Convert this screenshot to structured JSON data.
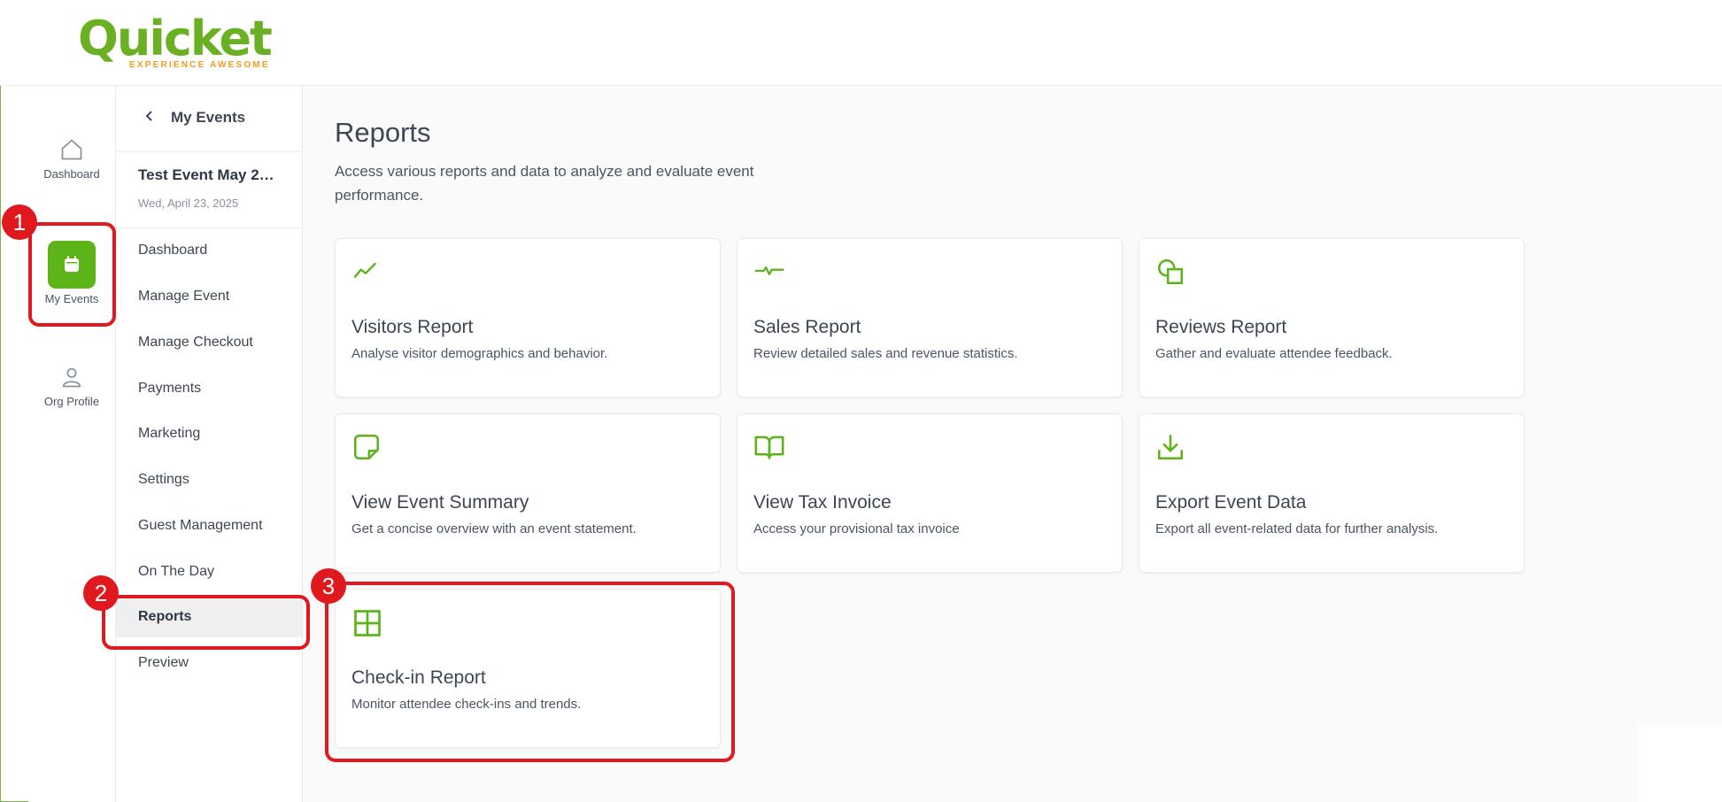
{
  "brand": {
    "name": "Quicket",
    "tagline": "EXPERIENCE AWESOME",
    "color": "#6ab023",
    "tagline_color": "#f39c1f"
  },
  "rail": [
    {
      "label": "Dashboard",
      "icon": "home-icon"
    },
    {
      "label": "My Events",
      "icon": "calendar-icon",
      "active": true
    },
    {
      "label": "Org Profile",
      "icon": "user-icon"
    }
  ],
  "subnav": {
    "back_label": "My Events",
    "event_name": "Test Event May 2…",
    "event_date": "Wed, April 23, 2025",
    "items": [
      "Dashboard",
      "Manage Event",
      "Manage Checkout",
      "Payments",
      "Marketing",
      "Settings",
      "Guest Management",
      "On The Day",
      "Reports",
      "Preview"
    ],
    "active_item": "Reports"
  },
  "main": {
    "title": "Reports",
    "description": "Access various reports and data to analyze and evaluate event performance.",
    "cards": [
      {
        "title": "Visitors Report",
        "desc": "Analyse visitor demographics and behavior.",
        "icon": "trend-line-icon"
      },
      {
        "title": "Sales Report",
        "desc": "Review detailed sales and revenue statistics.",
        "icon": "activity-pulse-icon"
      },
      {
        "title": "Reviews Report",
        "desc": "Gather and evaluate attendee feedback.",
        "icon": "shapes-icon"
      },
      {
        "title": "View Event Summary",
        "desc": "Get a concise overview with an event statement.",
        "icon": "sticky-note-icon"
      },
      {
        "title": "View Tax Invoice",
        "desc": "Access your provisional tax invoice",
        "icon": "open-book-icon"
      },
      {
        "title": "Export Event Data",
        "desc": "Export all event-related data for further analysis.",
        "icon": "download-icon"
      },
      {
        "title": "Check-in Report",
        "desc": "Monitor attendee check-ins and trends.",
        "icon": "grid-icon"
      }
    ]
  },
  "annotations": [
    "1",
    "2",
    "3"
  ],
  "colors": {
    "accent": "#5db418",
    "annotation": "#e0191f",
    "text": "#3d4654"
  }
}
